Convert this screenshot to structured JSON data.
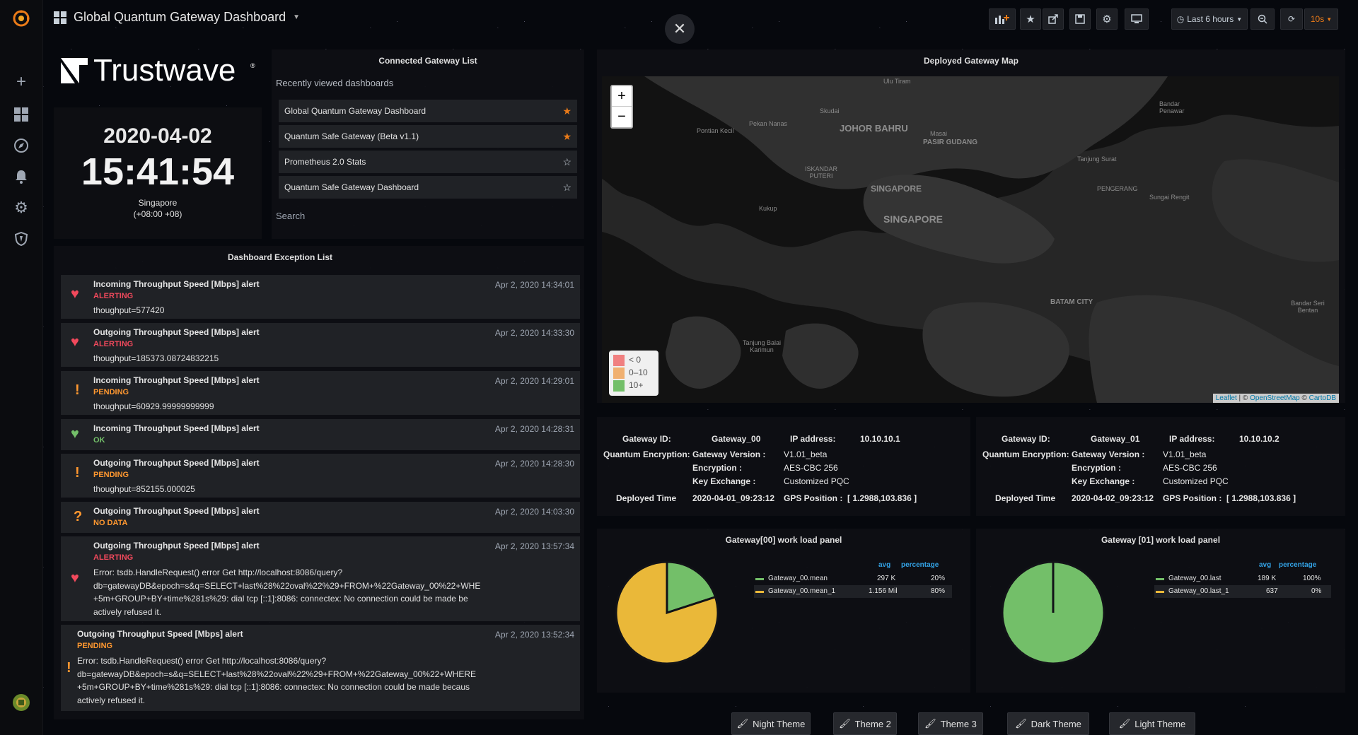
{
  "header": {
    "dashboard_title": "Global Quantum Gateway Dashboard",
    "time_range": "Last 6 hours",
    "refresh": "10s"
  },
  "clock": {
    "date": "2020-04-02",
    "time": "15:41:54",
    "zone": "Singapore",
    "offset": "(+08:00 +08)"
  },
  "logo": {
    "text": "Trustwave"
  },
  "connected_list": {
    "title": "Connected Gateway List",
    "recent_heading": "Recently viewed dashboards",
    "items": [
      {
        "label": "Global Quantum Gateway Dashboard",
        "starred": true
      },
      {
        "label": "Quantum Safe Gateway (Beta v1.1)",
        "starred": true
      },
      {
        "label": "Prometheus 2.0 Stats",
        "starred": false
      },
      {
        "label": "Quantum Safe Gateway Dashboard",
        "starred": false
      }
    ],
    "search_label": "Search"
  },
  "exceptions": {
    "title": "Dashboard Exception List",
    "items": [
      {
        "name": "Incoming Throughput Speed [Mbps] alert",
        "state": "ALERTING",
        "time": "Apr 2, 2020 14:34:01",
        "detail": "thoughput=577420"
      },
      {
        "name": "Outgoing Throughput Speed [Mbps] alert",
        "state": "ALERTING",
        "time": "Apr 2, 2020 14:33:30",
        "detail": "thoughput=185373.08724832215"
      },
      {
        "name": "Incoming Throughput Speed [Mbps] alert",
        "state": "PENDING",
        "time": "Apr 2, 2020 14:29:01",
        "detail": "thoughput=60929.99999999999"
      },
      {
        "name": "Incoming Throughput Speed [Mbps] alert",
        "state": "OK",
        "time": "Apr 2, 2020 14:28:31",
        "detail": ""
      },
      {
        "name": "Outgoing Throughput Speed [Mbps] alert",
        "state": "PENDING",
        "time": "Apr 2, 2020 14:28:30",
        "detail": "thoughput=852155.000025"
      },
      {
        "name": "Outgoing Throughput Speed [Mbps] alert",
        "state": "NO DATA",
        "time": "Apr 2, 2020 14:03:30",
        "detail": ""
      },
      {
        "name": "Outgoing Throughput Speed [Mbps] alert",
        "state": "ALERTING",
        "time": "Apr 2, 2020 13:57:34",
        "detail": "Error: tsdb.HandleRequest() error Get http://localhost:8086/query?\ndb=gatewayDB&epoch=s&q=SELECT+last%28%22oval%22%29+FROM+%22Gateway_00%22+WHE\n+5m+GROUP+BY+time%281s%29: dial tcp [::1]:8086: connectex: No connection could be made be\nactively refused it."
      },
      {
        "name": "Outgoing Throughput Speed [Mbps] alert",
        "state": "PENDING",
        "time": "Apr 2, 2020 13:52:34",
        "detail": "Error: tsdb.HandleRequest() error Get http://localhost:8086/query?\ndb=gatewayDB&epoch=s&q=SELECT+last%28%22oval%22%29+FROM+%22Gateway_00%22+WHERE\n+5m+GROUP+BY+time%281s%29: dial tcp [::1]:8086: connectex: No connection could be made becaus\nactively refused it."
      }
    ]
  },
  "map": {
    "title": "Deployed Gateway Map",
    "zoom_in": "+",
    "zoom_out": "−",
    "places": [
      "Ulu Tiram",
      "Skudai",
      "Pekan Nanas",
      "Pontian Kecil",
      "JOHOR BAHRU",
      "Masai",
      "PASIR GUDANG",
      "Bandar Penawar",
      "Tanjung Surat",
      "ISKANDAR PUTERI",
      "SINGAPORE",
      "PENGERANG",
      "Sungai Rengit",
      "Kukup",
      "SINGAPORE",
      "BATAM CITY",
      "Bandar Seri Bentan",
      "Tanjung Balai Karimun"
    ],
    "legend": [
      {
        "label": "< 0",
        "color": "#f2495c"
      },
      {
        "label": "0–10",
        "color": "#ff9830"
      },
      {
        "label": "10+",
        "color": "#73bf69"
      }
    ],
    "attribution": {
      "leaflet": "Leaflet",
      "mid": " | © ",
      "osm": "OpenStreetMap",
      "sep": " © ",
      "carto": "CartoDB"
    }
  },
  "gateways": [
    {
      "id_label": "Gateway ID:",
      "id": "Gateway_00",
      "ip_label": "IP address:",
      "ip": "10.10.10.1",
      "qe_label": "Quantum Encryption:",
      "ver_label": "Gateway Version :",
      "ver": "V1.01_beta",
      "enc_label": "Encryption :",
      "enc": "AES-CBC 256",
      "kx_label": "Key Exchange :",
      "kx": "Customized PQC",
      "dep_label": "Deployed Time",
      "dep": "2020-04-01_09:23:12",
      "gps_label": "GPS Position :",
      "gps": "[ 1.2988,103.836 ]"
    },
    {
      "id_label": "Gateway ID:",
      "id": "Gateway_01",
      "ip_label": "IP address:",
      "ip": "10.10.10.2",
      "qe_label": "Quantum Encryption:",
      "ver_label": "Gateway Version :",
      "ver": "V1.01_beta",
      "enc_label": "Encryption :",
      "enc": "AES-CBC 256",
      "kx_label": "Key Exchange :",
      "kx": "Customized PQC",
      "dep_label": "Deployed Time",
      "dep": "2020-04-02_09:23:12",
      "gps_label": "GPS Position :",
      "gps": "[ 1.2988,103.836 ]"
    }
  ],
  "chart_data": [
    {
      "type": "pie",
      "title": "Gateway[00] work load panel",
      "legend_headers": [
        "avg",
        "percentage"
      ],
      "slices": [
        {
          "name": "Gateway_00.mean",
          "value": 297000,
          "value_label": "297 K",
          "percent": 20,
          "percent_label": "20%",
          "color": "#73bf69"
        },
        {
          "name": "Gateway_00.mean_1",
          "value": 1156000,
          "value_label": "1.156 Mil",
          "percent": 80,
          "percent_label": "80%",
          "color": "#eab839"
        }
      ]
    },
    {
      "type": "pie",
      "title": "Gateway [01] work load panel",
      "legend_headers": [
        "avg",
        "percentage"
      ],
      "slices": [
        {
          "name": "Gateway_00.last",
          "value": 189000,
          "value_label": "189 K",
          "percent": 100,
          "percent_label": "100%",
          "color": "#73bf69"
        },
        {
          "name": "Gateway_00.last_1",
          "value": 637,
          "value_label": "637",
          "percent": 0,
          "percent_label": "0%",
          "color": "#eab839"
        }
      ]
    }
  ],
  "themes": [
    "Night Theme",
    "Theme 2",
    "Theme 3",
    "Dark Theme",
    "Light Theme"
  ],
  "colors": {
    "alerting": "#f2495c",
    "pending": "#ff9830",
    "ok": "#73bf69",
    "accent": "#eb7b18"
  }
}
